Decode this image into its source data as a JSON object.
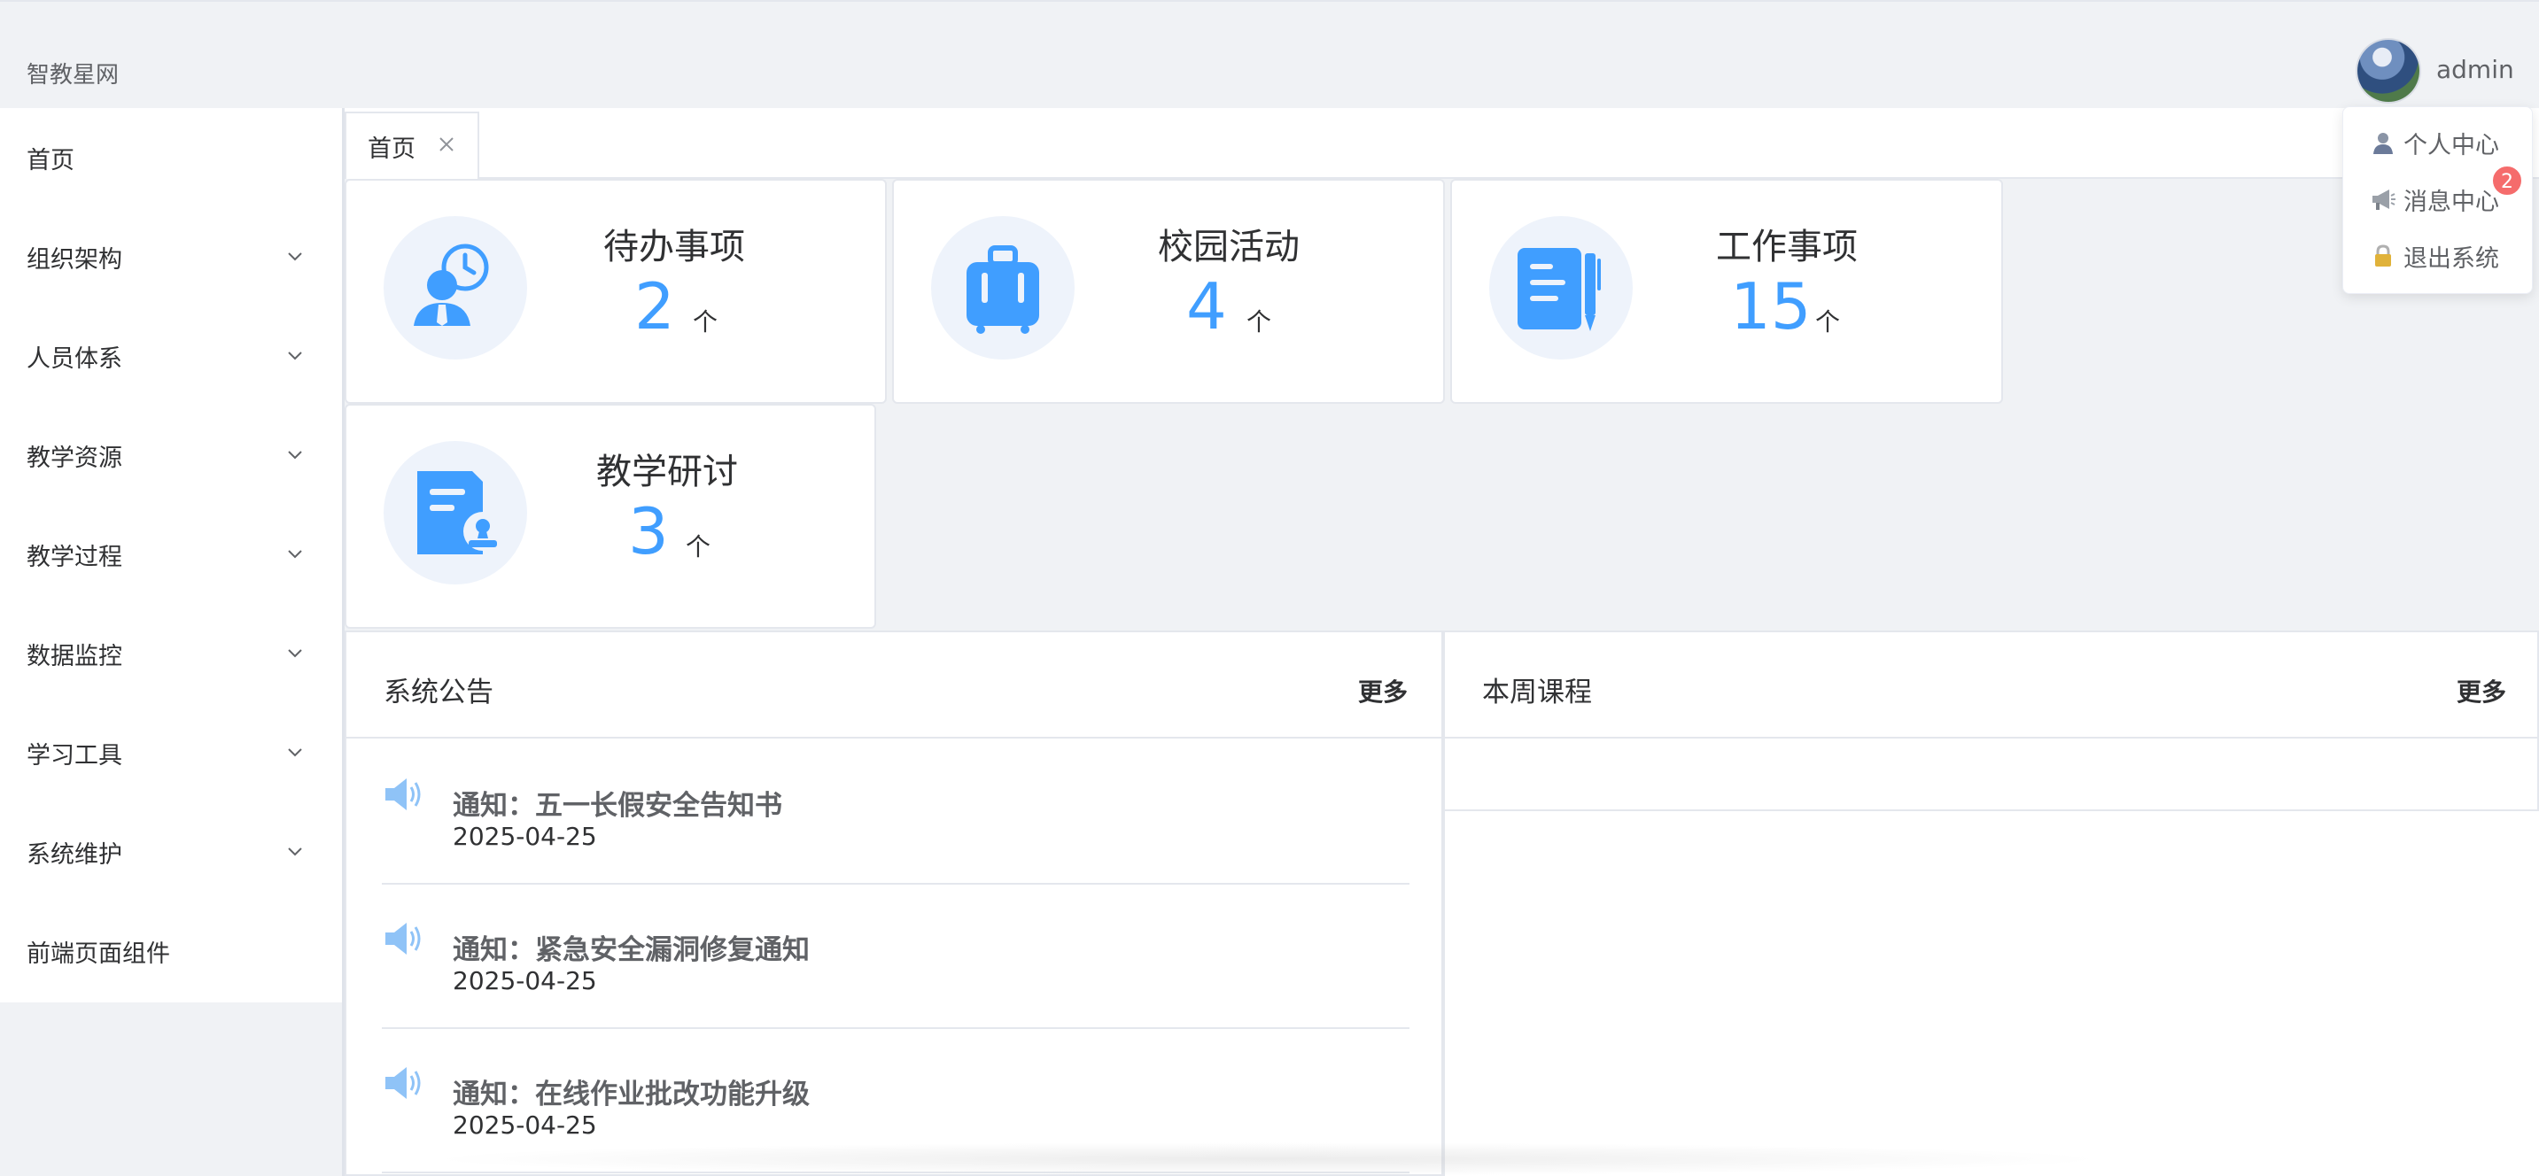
{
  "app": {
    "brand": "智教星网"
  },
  "user": {
    "name": "admin"
  },
  "user_menu": {
    "items": [
      {
        "label": "个人中心",
        "icon": "user-icon"
      },
      {
        "label": "消息中心",
        "icon": "megaphone-icon"
      },
      {
        "label": "退出系统",
        "icon": "lock-icon"
      }
    ],
    "message_badge": "2"
  },
  "sidebar": {
    "items": [
      {
        "label": "首页",
        "has_children": false
      },
      {
        "label": "组织架构",
        "has_children": true
      },
      {
        "label": "人员体系",
        "has_children": true
      },
      {
        "label": "教学资源",
        "has_children": true
      },
      {
        "label": "教学过程",
        "has_children": true
      },
      {
        "label": "数据监控",
        "has_children": true
      },
      {
        "label": "学习工具",
        "has_children": true
      },
      {
        "label": "系统维护",
        "has_children": true
      },
      {
        "label": "前端页面组件",
        "has_children": false
      }
    ]
  },
  "tabs": [
    {
      "label": "首页"
    }
  ],
  "stats": [
    {
      "title": "待办事项",
      "count": "2",
      "unit": "个",
      "icon": "person-clock-icon"
    },
    {
      "title": "校园活动",
      "count": "4",
      "unit": "个",
      "icon": "suitcase-icon"
    },
    {
      "title": "工作事项",
      "count": "15",
      "unit": "个",
      "icon": "notebook-pen-icon"
    },
    {
      "title": "教学研讨",
      "count": "3",
      "unit": "个",
      "icon": "document-stamp-icon"
    }
  ],
  "announcements": {
    "title": "系统公告",
    "more": "更多",
    "items": [
      {
        "title": "通知：五一长假安全告知书",
        "date": "2025-04-25"
      },
      {
        "title": "通知：紧急安全漏洞修复通知",
        "date": "2025-04-25"
      },
      {
        "title": "通知：在线作业批改功能升级",
        "date": "2025-04-25"
      }
    ]
  },
  "courses": {
    "title": "本周课程",
    "more": "更多"
  },
  "colors": {
    "accent": "#409eff",
    "badge": "#f56c6c",
    "icon_bg": "#eef3fb"
  }
}
